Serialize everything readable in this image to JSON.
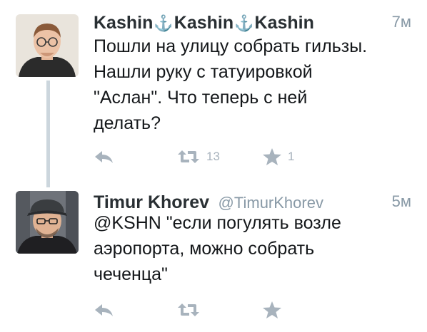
{
  "tweets": [
    {
      "name_parts": [
        "Kashin",
        "Kashin",
        "Kashin"
      ],
      "handle": "",
      "time": "7м",
      "text": "Пошли на улицу собрать гильзы.\nНашли руку с татуировкой\n\"Аслан\". Что теперь с ней\nделать?",
      "retweets": "13",
      "favorites": "1"
    },
    {
      "name": "Timur Khorev",
      "handle": "@TimurKhorev",
      "time": "5м",
      "text": "@KSHN \"если погулять возле\nаэропорта, можно собрать\nчеченца\"",
      "retweets": "",
      "favorites": ""
    }
  ],
  "icons": {
    "name_separator": "anchor-icon",
    "reply": "reply-icon",
    "retweet": "retweet-icon",
    "favorite": "star-icon"
  },
  "colors": {
    "action_gray": "#a8b3bd",
    "anchor_blue": "#3b94d9",
    "secondary_text": "#8899a6"
  }
}
